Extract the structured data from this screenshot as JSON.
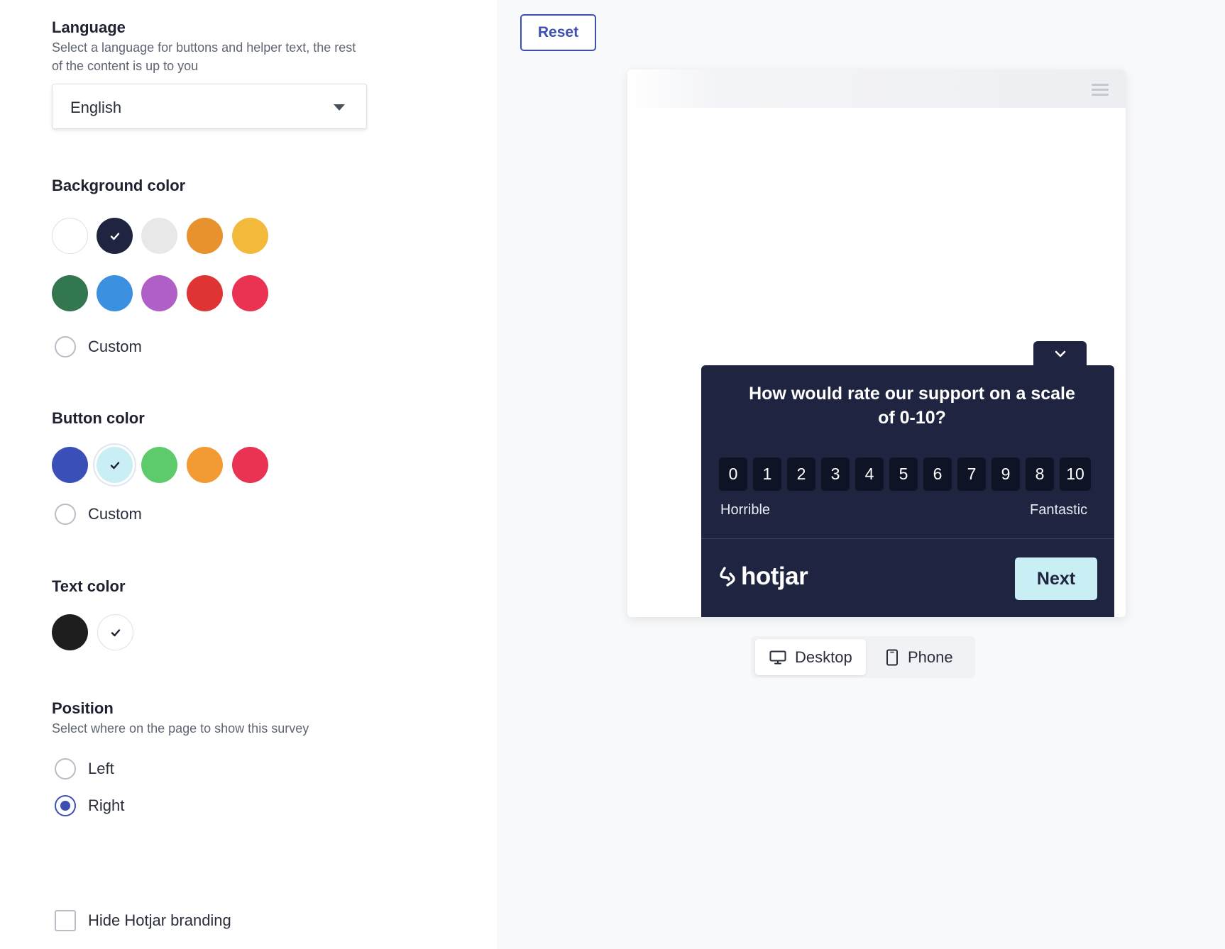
{
  "language": {
    "title": "Language",
    "help": "Select a language for buttons and helper text, the rest of the content is up to you",
    "selected": "English"
  },
  "background_color": {
    "title": "Background color",
    "swatches": [
      "#ffffff",
      "#1f2440",
      "#e8e8e8",
      "#e8922f",
      "#f2b93b",
      "#327750",
      "#3b90e0",
      "#b05fc6",
      "#df3434",
      "#ea3353"
    ],
    "selected": "#1f2440",
    "custom_label": "Custom"
  },
  "button_color": {
    "title": "Button color",
    "swatches": [
      "#3b4fb8",
      "#c9eef3",
      "#5dcb6b",
      "#f29b35",
      "#ea3353"
    ],
    "selected": "#c9eef3",
    "custom_label": "Custom"
  },
  "text_color": {
    "title": "Text color",
    "swatches": [
      "#1e1e1e",
      "#ffffff"
    ],
    "selected": "#ffffff"
  },
  "position": {
    "title": "Position",
    "help": "Select where on the page to show this survey",
    "options": [
      "Left",
      "Right"
    ],
    "selected": "Right"
  },
  "branding": {
    "label": "Hide Hotjar branding",
    "checked": false
  },
  "preview": {
    "reset_label": "Reset",
    "question": "How would rate our support on a scale of 0-10?",
    "scale": [
      "0",
      "1",
      "2",
      "3",
      "4",
      "5",
      "6",
      "7",
      "9",
      "8",
      "10"
    ],
    "low_label": "Horrible",
    "high_label": "Fantastic",
    "brand": "hotjar",
    "next_label": "Next",
    "devices": [
      "Desktop",
      "Phone"
    ],
    "active_device": "Desktop"
  },
  "icons": [
    "check-icon",
    "chevron-down-icon",
    "hamburger-menu-icon",
    "hotjar-logo-icon",
    "desktop-icon",
    "phone-icon",
    "caret-down-icon"
  ]
}
